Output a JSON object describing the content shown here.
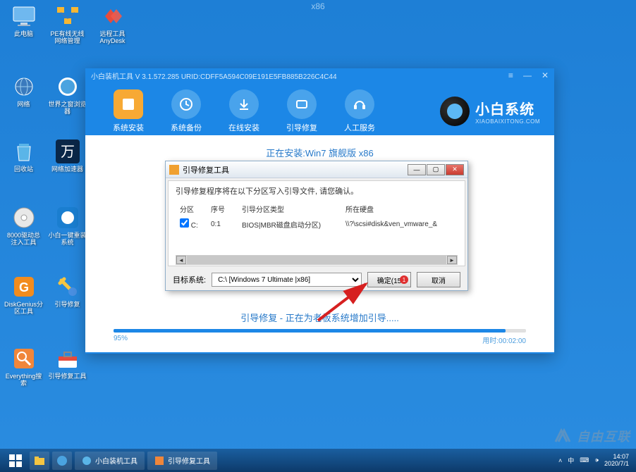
{
  "top_arch_label": "x86",
  "desktop_icons": {
    "r1c1": "此电脑",
    "r1c2": "PE有线无线网络管理",
    "r1c3": "远程工具AnyDesk",
    "r2c1": "网络",
    "r2c2": "世界之窗浏览器",
    "r3c1": "回收站",
    "r3c2": "网络加速器",
    "r4c1": "8000驱动总注入工具",
    "r4c2": "小白一键重装系统",
    "r5c1": "DiskGenius分区工具",
    "r5c2": "引导修复",
    "r6c1": "Everything搜索",
    "r6c2": "引导修复工具"
  },
  "main_window": {
    "title": "小白装机工具 V 3.1.572.285 URID:CDFF5A594C09E191E5FB885B226C4C44",
    "toolbar": {
      "install": "系统安装",
      "backup": "系统备份",
      "online": "在线安装",
      "boot": "引导修复",
      "service": "人工服务"
    },
    "logo": {
      "main": "小白系统",
      "sub": "XIAOBAIXITONG.COM"
    },
    "install_title": "正在安装:Win7 旗舰版 x86",
    "status": "引导修复 - 正在为老板系统增加引导.....",
    "progress": {
      "percent": "95%",
      "time": "用时:00:02:00",
      "value": 95
    }
  },
  "dialog": {
    "title": "引导修复工具",
    "message": "引导修复程序将在以下分区写入引导文件, 请您确认。",
    "headers": {
      "partition": "分区",
      "seq": "序号",
      "type": "引导分区类型",
      "disk": "所在硬盘"
    },
    "row": {
      "partition": "C:",
      "seq": "0:1",
      "type": "BIOS|MBR磁盘启动分区)",
      "disk": "\\\\?\\scsi#disk&ven_vmware_&"
    },
    "os_label": "目标系统:",
    "os_value": "C:\\ [Windows 7 Ultimate |x86]",
    "btn_ok": "确定(15",
    "btn_cancel": "取消",
    "badge": "1"
  },
  "watermark": "自由互联",
  "taskbar": {
    "item1": "小白装机工具",
    "item2": "引导修复工具",
    "time": "14:07",
    "date": "2020/7/1"
  }
}
